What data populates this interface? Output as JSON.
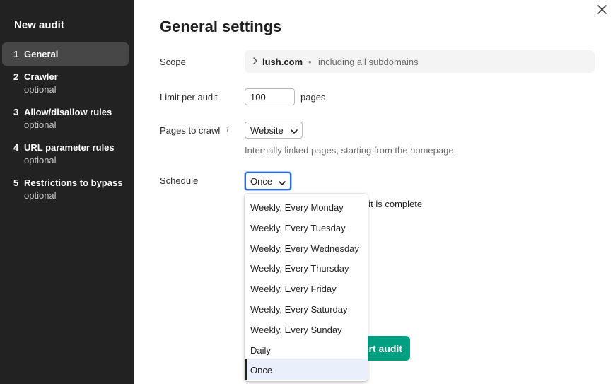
{
  "sidebar": {
    "title": "New audit",
    "steps": [
      {
        "num": "1",
        "label": "General",
        "sub": ""
      },
      {
        "num": "2",
        "label": "Crawler",
        "sub": "optional"
      },
      {
        "num": "3",
        "label": "Allow/disallow rules",
        "sub": "optional"
      },
      {
        "num": "4",
        "label": "URL parameter rules",
        "sub": "optional"
      },
      {
        "num": "5",
        "label": "Restrictions to bypass",
        "sub": "optional"
      }
    ]
  },
  "main": {
    "title": "General settings",
    "scope": {
      "label": "Scope",
      "domain": "lush.com",
      "separator": "•",
      "note": "including all subdomains"
    },
    "limit": {
      "label": "Limit per audit",
      "value": "100",
      "unit": "pages"
    },
    "pages_to_crawl": {
      "label": "Pages to crawl",
      "info_icon": "i",
      "selected": "Website",
      "hint": "Internally linked pages, starting from the homepage."
    },
    "schedule": {
      "label": "Schedule",
      "selected": "Once",
      "partial_text": "dit is complete",
      "options": [
        "Weekly, Every Monday",
        "Weekly, Every Tuesday",
        "Weekly, Every Wednesday",
        "Weekly, Every Thursday",
        "Weekly, Every Friday",
        "Weekly, Every Saturday",
        "Weekly, Every Sunday",
        "Daily",
        "Once"
      ]
    },
    "start_button_visible": "rt audit"
  },
  "colors": {
    "sidebar_bg": "#222222",
    "active_step_bg": "#474747",
    "accent_green": "#009f81",
    "focus_blue": "#2f6bd8",
    "selected_option_bg": "#e9effb"
  },
  "icons": {
    "close": "close-icon",
    "scope_chevron": "chevron-right-icon",
    "select_chevron": "chevron-down-icon",
    "info": "info-icon"
  }
}
